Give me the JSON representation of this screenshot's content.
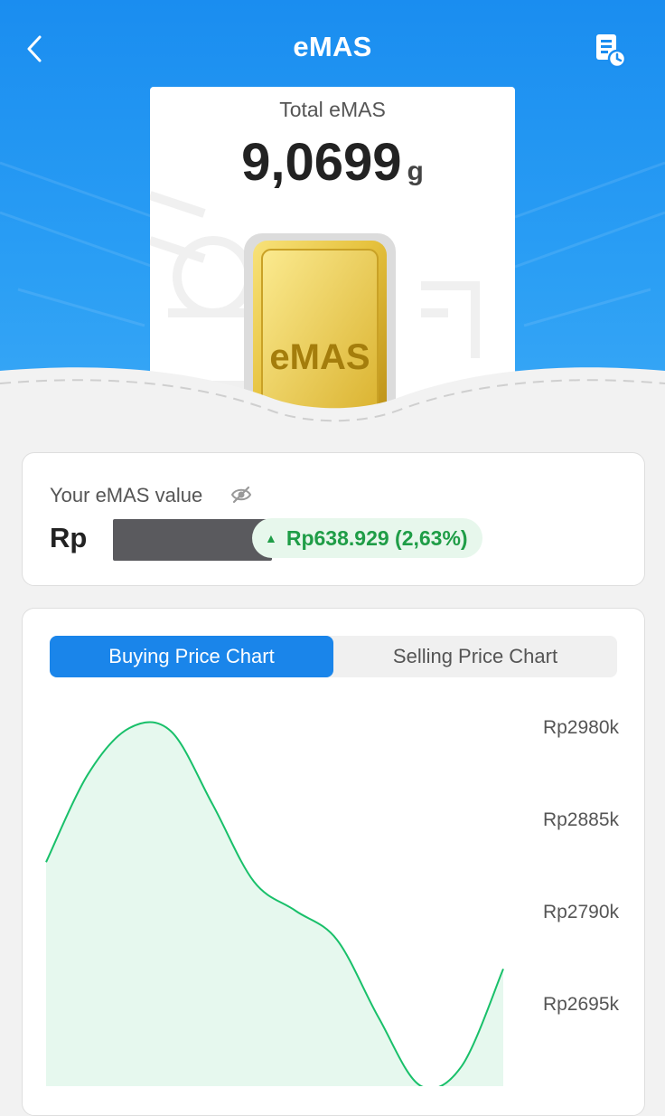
{
  "header": {
    "title": "eMAS",
    "back_icon": "chevron-left-icon",
    "history_icon": "document-clock-icon"
  },
  "summary_card": {
    "label": "Total eMAS",
    "value": "9,0699",
    "unit": "g",
    "gold_bar_text": "eMAS"
  },
  "value_panel": {
    "label": "Your eMAS value",
    "currency": "Rp",
    "change": "Rp638.929 (2,63%)",
    "change_direction": "up",
    "change_color": "#1f9d47",
    "hidden_icon": "eye-off-icon"
  },
  "chart_tabs": [
    {
      "label": "Buying Price Chart",
      "active": true
    },
    {
      "label": "Selling Price Chart",
      "active": false
    }
  ],
  "colors": {
    "brand": "#1a8df0",
    "line": "#19c06a",
    "area": "#e6f8ee"
  },
  "chart_data": {
    "type": "area",
    "title": "",
    "xlabel": "",
    "ylabel": "",
    "y_tick_labels": [
      "Rp2980k",
      "Rp2885k",
      "Rp2790k",
      "Rp2695k"
    ],
    "y_ticks": [
      2980,
      2885,
      2790,
      2695
    ],
    "ylim": [
      2600,
      3000
    ],
    "x": [
      0,
      1,
      2,
      3,
      4,
      5,
      6,
      7,
      8,
      9,
      10,
      11
    ],
    "values": [
      2840,
      2930,
      2978,
      2975,
      2900,
      2820,
      2790,
      2760,
      2680,
      2610,
      2630,
      2730
    ],
    "grid": false,
    "legend": "none"
  }
}
